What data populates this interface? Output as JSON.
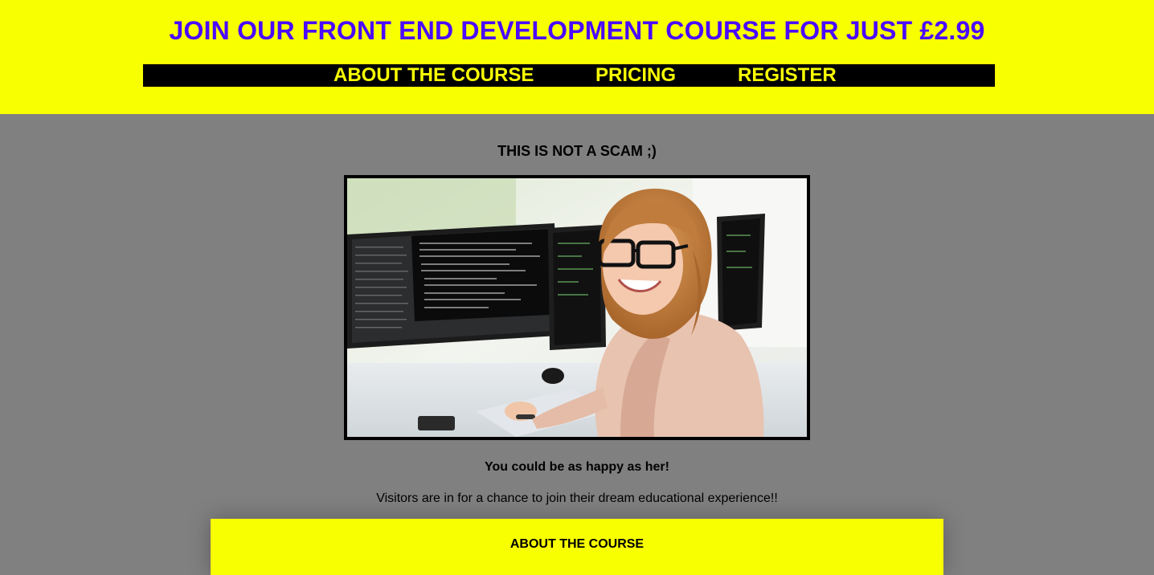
{
  "header": {
    "headline": "JOIN OUR FRONT END DEVELOPMENT COURSE FOR JUST £2.99",
    "nav": {
      "about": "ABOUT THE COURSE",
      "pricing": "PRICING",
      "register": "REGISTER"
    }
  },
  "main": {
    "subheading": "THIS IS NOT A SCAM ;)",
    "caption": "You could be as happy as her!",
    "description": "Visitors are in for a chance to join their dream educational experience!!",
    "about_section_title": "ABOUT THE COURSE"
  },
  "colors": {
    "header_background": "#f8ff00",
    "headline_text": "#4a0bff",
    "nav_background": "#000000",
    "nav_text": "#f8ff00",
    "page_background": "#808080"
  }
}
